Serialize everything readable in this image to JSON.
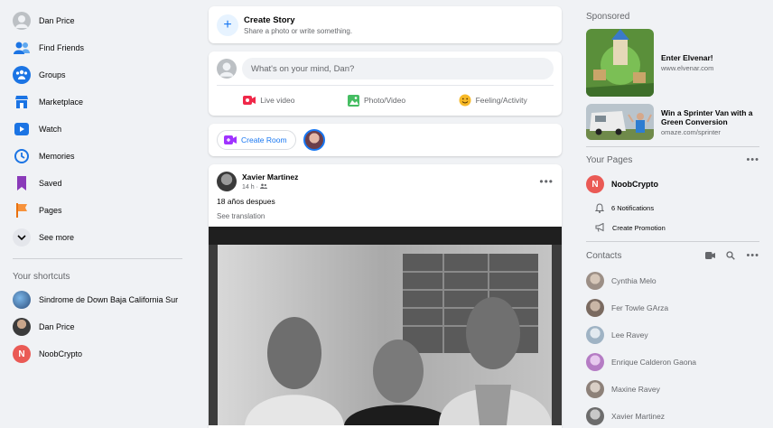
{
  "left_nav": {
    "items": [
      {
        "label": "Dan Price",
        "icon": "profile-avatar"
      },
      {
        "label": "Find Friends",
        "icon": "friends-icon"
      },
      {
        "label": "Groups",
        "icon": "groups-icon"
      },
      {
        "label": "Marketplace",
        "icon": "marketplace-icon"
      },
      {
        "label": "Watch",
        "icon": "watch-icon"
      },
      {
        "label": "Memories",
        "icon": "memories-icon"
      },
      {
        "label": "Saved",
        "icon": "saved-icon"
      },
      {
        "label": "Pages",
        "icon": "pages-icon"
      },
      {
        "label": "See more",
        "icon": "chevron-down-icon"
      }
    ],
    "shortcuts_title": "Your shortcuts",
    "shortcuts": [
      {
        "label": "Sindrome de Down Baja California Sur"
      },
      {
        "label": "Dan Price"
      },
      {
        "label": "NoobCrypto",
        "initial": "N"
      }
    ]
  },
  "story": {
    "title": "Create Story",
    "subtitle": "Share a photo or write something."
  },
  "composer": {
    "placeholder": "What's on your mind, Dan?",
    "actions": [
      {
        "label": "Live video",
        "color": "#f02849"
      },
      {
        "label": "Photo/Video",
        "color": "#45bd62"
      },
      {
        "label": "Feeling/Activity",
        "color": "#f7b928"
      }
    ]
  },
  "room": {
    "label": "Create Room"
  },
  "post": {
    "author": "Xavier Martinez",
    "time": "14 h ·",
    "text": "18 años despues",
    "translate": "See translation"
  },
  "right": {
    "sponsored_title": "Sponsored",
    "ads": [
      {
        "title": "Enter Elvenar!",
        "url": "www.elvenar.com"
      },
      {
        "title": "Win a Sprinter Van with a Green Conversion",
        "url": "omaze.com/sprinter"
      }
    ],
    "pages_title": "Your Pages",
    "page": {
      "name": "NoobCrypto",
      "initial": "N",
      "notifications": "6 Notifications",
      "promotion": "Create Promotion"
    },
    "contacts_title": "Contacts",
    "contacts": [
      {
        "name": "Cynthia Melo"
      },
      {
        "name": "Fer Towle GArza"
      },
      {
        "name": "Lee Ravey"
      },
      {
        "name": "Enrique Calderon Gaona"
      },
      {
        "name": "Maxine Ravey"
      },
      {
        "name": "Xavier Martinez"
      }
    ]
  },
  "colors": {
    "brand": "#1877f2",
    "background": "#f0f2f5",
    "muted": "#65676b"
  }
}
